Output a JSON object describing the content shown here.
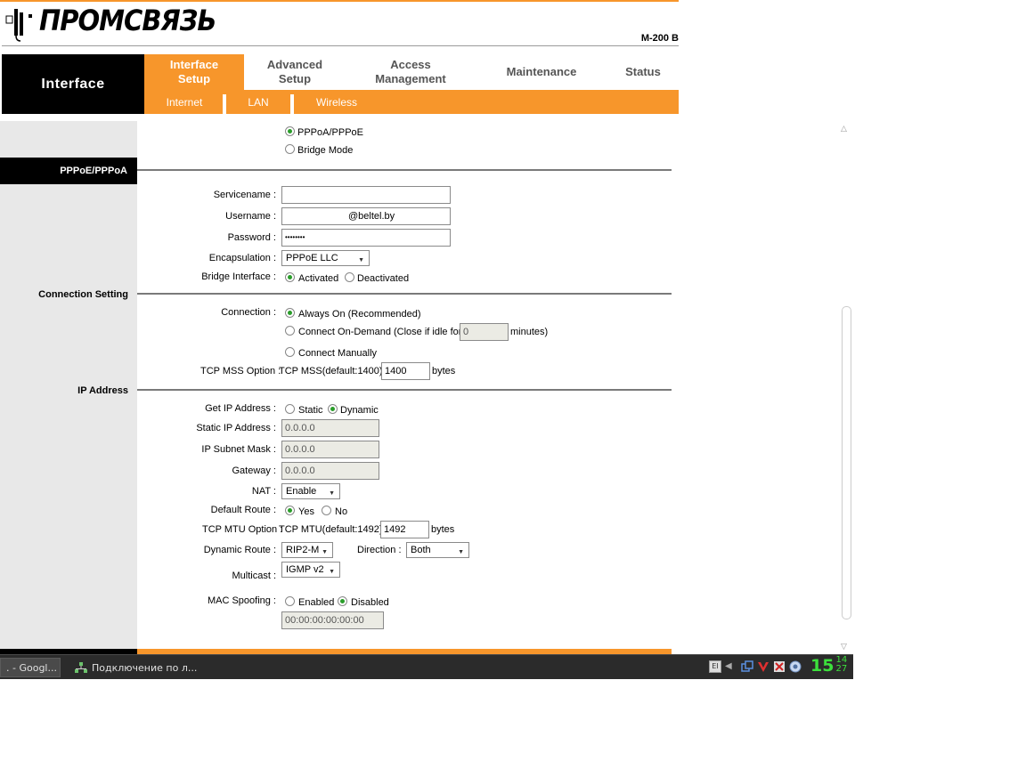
{
  "header": {
    "logo_text": "ПРОМСВЯЗЬ",
    "model": "M-200 B"
  },
  "nav": {
    "section_title": "Interface",
    "tabs": [
      {
        "label_line1": "Interface",
        "label_line2": "Setup",
        "active": true
      },
      {
        "label_line1": "Advanced",
        "label_line2": "Setup",
        "active": false
      },
      {
        "label_line1": "Access",
        "label_line2": "Management",
        "active": false
      },
      {
        "label_line1": "Maintenance",
        "label_line2": "",
        "active": false
      },
      {
        "label_line1": "Status",
        "label_line2": "",
        "active": false
      }
    ],
    "subtabs": [
      "Internet",
      "LAN",
      "Wireless"
    ]
  },
  "encap_mode": {
    "options": [
      "PPPoA/PPPoE",
      "Bridge Mode"
    ],
    "selected": "PPPoA/PPPoE"
  },
  "pppoe": {
    "section": "PPPoE/PPPoA",
    "servicename_label": "Servicename :",
    "servicename_value": "",
    "username_label": "Username :",
    "username_value": "@beltel.by",
    "password_label": "Password :",
    "password_value": "••••••••",
    "encapsulation_label": "Encapsulation :",
    "encapsulation_value": "PPPoE LLC",
    "bridge_label": "Bridge Interface :",
    "bridge_options": [
      "Activated",
      "Deactivated"
    ],
    "bridge_selected": "Activated"
  },
  "connection": {
    "section": "Connection Setting",
    "label": "Connection :",
    "always_on": "Always On (Recommended)",
    "on_demand_prefix": "Connect On-Demand (Close if idle for",
    "on_demand_value": "0",
    "on_demand_suffix": "minutes)",
    "manual": "Connect Manually",
    "selected": "always_on",
    "mss_label": "TCP MSS Option :",
    "mss_text": "TCP MSS(default:1400)",
    "mss_value": "1400",
    "mss_unit": "bytes"
  },
  "ip": {
    "section": "IP Address",
    "get_ip_label": "Get IP Address :",
    "get_ip_options": [
      "Static",
      "Dynamic"
    ],
    "get_ip_selected": "Dynamic",
    "static_ip_label": "Static IP Address :",
    "static_ip_value": "0.0.0.0",
    "subnet_label": "IP Subnet Mask :",
    "subnet_value": "0.0.0.0",
    "gateway_label": "Gateway :",
    "gateway_value": "0.0.0.0",
    "nat_label": "NAT :",
    "nat_value": "Enable",
    "default_route_label": "Default Route :",
    "default_route_options": [
      "Yes",
      "No"
    ],
    "default_route_selected": "Yes",
    "mtu_label": "TCP MTU Option :",
    "mtu_text": "TCP MTU(default:1492)",
    "mtu_value": "1492",
    "mtu_unit": "bytes",
    "dynamic_route_label": "Dynamic Route :",
    "dynamic_route_value": "RIP2-M",
    "direction_label": "Direction :",
    "direction_value": "Both",
    "multicast_label": "Multicast :",
    "multicast_value": "IGMP v2",
    "mac_label": "MAC Spoofing :",
    "mac_options": [
      "Enabled",
      "Disabled"
    ],
    "mac_selected": "Disabled",
    "mac_value": "00:00:00:00:00:00"
  },
  "taskbar": {
    "item1": ". - Googl...",
    "item2": "Подключение по л...",
    "clock_hour": "15",
    "clock_min1": "14",
    "clock_min2": "27"
  },
  "colors": {
    "accent_orange": "#f7962b",
    "radio_green": "#2a9d2a",
    "clock_green": "#3ce03c"
  }
}
